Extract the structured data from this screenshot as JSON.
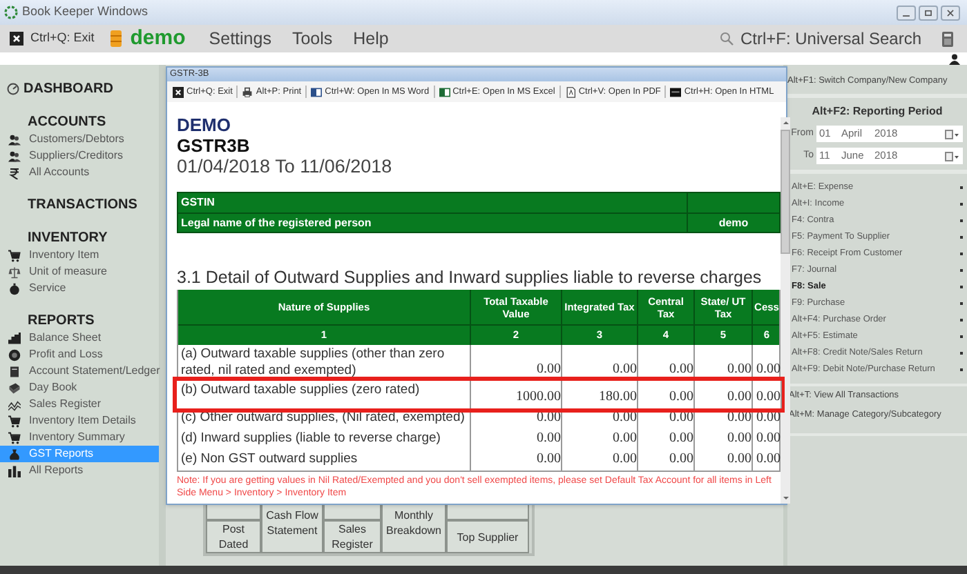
{
  "window": {
    "title": "Book Keeper Windows"
  },
  "menubar": {
    "exit": "Ctrl+Q: Exit",
    "company": "demo",
    "menus": [
      "Settings",
      "Tools",
      "Help"
    ],
    "search": "Ctrl+F: Universal Search"
  },
  "sidebar": {
    "sections": [
      {
        "heading": "DASHBOARD",
        "kind": "gauge"
      },
      {
        "heading": "ACCOUNTS",
        "items": [
          {
            "label": "Customers/Debtors",
            "kind": "people",
            "selected": false
          },
          {
            "label": "Suppliers/Creditors",
            "kind": "people",
            "selected": false
          },
          {
            "label": "All Accounts",
            "kind": "rupee",
            "selected": false
          }
        ]
      },
      {
        "heading": "TRANSACTIONS"
      },
      {
        "heading": "INVENTORY",
        "items": [
          {
            "label": "Inventory Item",
            "kind": "cart",
            "selected": false
          },
          {
            "label": "Unit of measure",
            "kind": "scale",
            "selected": false
          },
          {
            "label": "Service",
            "kind": "timer",
            "selected": false
          }
        ]
      },
      {
        "heading": "REPORTS",
        "items": [
          {
            "label": "Balance Sheet",
            "kind": "steps",
            "selected": false
          },
          {
            "label": "Profit and Loss",
            "kind": "coin",
            "selected": false
          },
          {
            "label": "Account Statement/Ledger",
            "kind": "ledger",
            "selected": false
          },
          {
            "label": "Day Book",
            "kind": "book",
            "selected": false
          },
          {
            "label": "Sales Register",
            "kind": "wave",
            "selected": false
          },
          {
            "label": "Inventory Item Details",
            "kind": "cart",
            "selected": false
          },
          {
            "label": "Inventory Summary",
            "kind": "cart",
            "selected": false
          },
          {
            "label": "GST Reports",
            "kind": "bag",
            "selected": true
          },
          {
            "label": "All Reports",
            "kind": "bars",
            "selected": false
          }
        ]
      }
    ]
  },
  "tiles": [
    {
      "label": "Post Dated"
    },
    {
      "label": "Cash Flow Statement"
    },
    {
      "label": "Sales Register"
    },
    {
      "label": "Monthly Breakdown"
    },
    {
      "label": "Top Supplier"
    }
  ],
  "dialog": {
    "title": "GSTR-3B",
    "toolbar": [
      {
        "label": "Ctrl+Q: Exit",
        "kind": "exit"
      },
      {
        "label": "Alt+P: Print",
        "kind": "print"
      },
      {
        "label": "Ctrl+W: Open In MS Word",
        "kind": "word"
      },
      {
        "label": "Ctrl+E: Open In MS Excel",
        "kind": "excel"
      },
      {
        "label": "Ctrl+V: Open In PDF",
        "kind": "pdf"
      },
      {
        "label": "Ctrl+H: Open In HTML",
        "kind": "html"
      }
    ],
    "company": "DEMO",
    "report": "GSTR3B",
    "period": "01/04/2018 To 11/06/2018",
    "info_table": [
      {
        "label": "GSTIN"
      },
      {
        "label": "Legal name of the registered person",
        "value": "demo"
      }
    ],
    "section_title": "3.1 Detail of Outward Supplies and Inward supplies liable to reverse charges",
    "table": {
      "columns": [
        "Nature of Supplies",
        "Total Taxable Value",
        "Integrated Tax",
        "Central Tax",
        "State/ UT Tax",
        "Cess"
      ],
      "numbers": [
        "1",
        "2",
        "3",
        "4",
        "5",
        "6"
      ],
      "rows": [
        {
          "label": "(a) Outward taxable supplies (other than zero rated, nil rated and exempted)",
          "values": [
            "0.00",
            "0.00",
            "0.00",
            "0.00",
            "0.00"
          ],
          "highlighted": false
        },
        {
          "label": "(b) Outward taxable supplies (zero rated)",
          "values": [
            "1000.00",
            "180.00",
            "0.00",
            "0.00",
            "0.00"
          ],
          "highlighted": true
        },
        {
          "label": "(c) Other outward supplies, (Nil rated, exempted)",
          "values": [
            "0.00",
            "0.00",
            "0.00",
            "0.00",
            "0.00"
          ],
          "highlighted": false
        },
        {
          "label": "(d) Inward supplies (liable to reverse charge)",
          "values": [
            "0.00",
            "0.00",
            "0.00",
            "0.00",
            "0.00"
          ],
          "highlighted": false
        },
        {
          "label": "(e) Non GST outward supplies",
          "values": [
            "0.00",
            "0.00",
            "0.00",
            "0.00",
            "0.00"
          ],
          "highlighted": false
        }
      ]
    },
    "note": "Note: If you are getting values in Nil Rated/Exempted and you don't sell exempted items, please set Default Tax Account for all items in Left Side Menu > Inventory > Inventory Item"
  },
  "right_panel": {
    "switch": "Alt+F1: Switch Company/New Company",
    "period": {
      "title": "Alt+F2: Reporting Period",
      "from": {
        "label": "From",
        "day": "01",
        "month": "April",
        "year": "2018"
      },
      "to": {
        "label": "To",
        "day": "11",
        "month": "June",
        "year": "2018"
      }
    },
    "actions": [
      {
        "label": "Alt+E: Expense",
        "selected": false
      },
      {
        "label": "Alt+I: Income",
        "selected": false
      },
      {
        "label": "F4: Contra",
        "selected": false
      },
      {
        "label": "F5: Payment To Supplier",
        "selected": false
      },
      {
        "label": "F6: Receipt From Customer",
        "selected": false
      },
      {
        "label": "F7: Journal",
        "selected": false
      },
      {
        "label": "F8: Sale",
        "selected": true
      },
      {
        "label": "F9: Purchase",
        "selected": false
      },
      {
        "label": "Alt+F4: Purchase Order",
        "selected": false
      },
      {
        "label": "Alt+F5: Estimate",
        "selected": false
      },
      {
        "label": "Alt+F8: Credit Note/Sales Return",
        "selected": false
      },
      {
        "label": "Alt+F9: Debit Note/Purchase Return",
        "selected": false
      }
    ],
    "links": [
      "Alt+T: View All Transactions",
      "Alt+M: Manage Category/Subcategory"
    ]
  }
}
